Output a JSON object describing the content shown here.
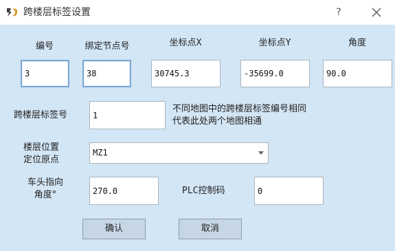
{
  "window": {
    "title": "跨楼层标签设置",
    "help_label": "?"
  },
  "fields": {
    "id_label": "编号",
    "id_value": "3",
    "bound_node_label": "绑定节点号",
    "bound_node_value": "38",
    "x_label": "坐标点X",
    "x_value": "30745.3",
    "y_label": "坐标点Y",
    "y_value": "-35699.0",
    "angle_label": "角度",
    "angle_value": "90.0",
    "cross_floor_label": "跨楼层标签号",
    "cross_floor_value": "1",
    "note_line1": "不同地图中的跨楼层标签编号相同",
    "note_line2": "代表此处两个地图相通",
    "floor_origin_label_line1": "楼层位置",
    "floor_origin_label_line2": "定位原点",
    "floor_origin_value": "MZ1",
    "heading_label_line1": "车头指向",
    "heading_label_line2": "角度°",
    "heading_value": "270.0",
    "plc_label": "PLC控制码",
    "plc_value": "0"
  },
  "buttons": {
    "confirm": "确认",
    "cancel": "取消"
  },
  "icons": {
    "app": "app-logo-icon",
    "close": "close-icon",
    "dropdown": "chevron-down-icon"
  }
}
